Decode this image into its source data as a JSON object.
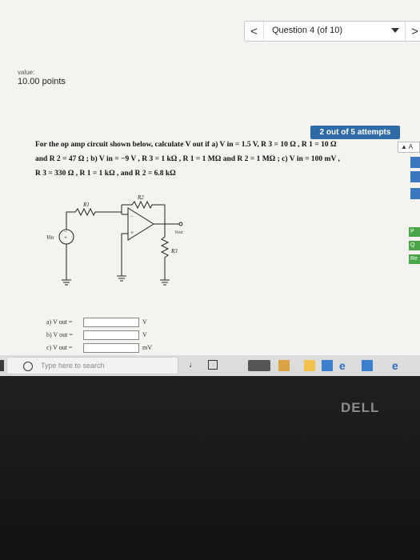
{
  "question_nav": {
    "prev_glyph": "<",
    "title": "Question 4 (of 10)",
    "next_glyph": ">"
  },
  "score": {
    "label": "value:",
    "points": "10.00 points"
  },
  "attempts": "2 out of 5 attempts",
  "question": {
    "line1": "For the op amp circuit shown below, calculate V out if a) V in = 1.5 V, R 3 = 10 Ω , R 1 = 10 Ω",
    "line2": "and R 2 = 47 Ω ; b) V in = −9 V , R 3 = 1 kΩ , R 1 = 1 MΩ and R 2 = 1 MΩ ; c) V in = 100 mV ,",
    "line3": "R 3 = 330 Ω , R 1 = 1 kΩ , and R 2 = 6.8 kΩ"
  },
  "circuit": {
    "r2_label": "R2",
    "r1_label": "R1",
    "r3_label": "R3",
    "vin_label": "Vin",
    "vout_label": "Vout"
  },
  "answers": [
    {
      "label": "a) V out =",
      "value": "",
      "unit": "V"
    },
    {
      "label": "b) V out =",
      "value": "",
      "unit": "V"
    },
    {
      "label": "c) V out =",
      "value": "",
      "unit": "mV"
    }
  ],
  "side_panel": {
    "tab_label": "A",
    "items": [
      "P",
      "Q",
      "Re"
    ]
  },
  "taskbar": {
    "search_placeholder": "Type here to search"
  },
  "bezel": {
    "brand": "DELL"
  },
  "colors": {
    "badge_blue": "#2d6aa6",
    "side_blue": "#3b78c0",
    "side_green": "#4aa548"
  }
}
